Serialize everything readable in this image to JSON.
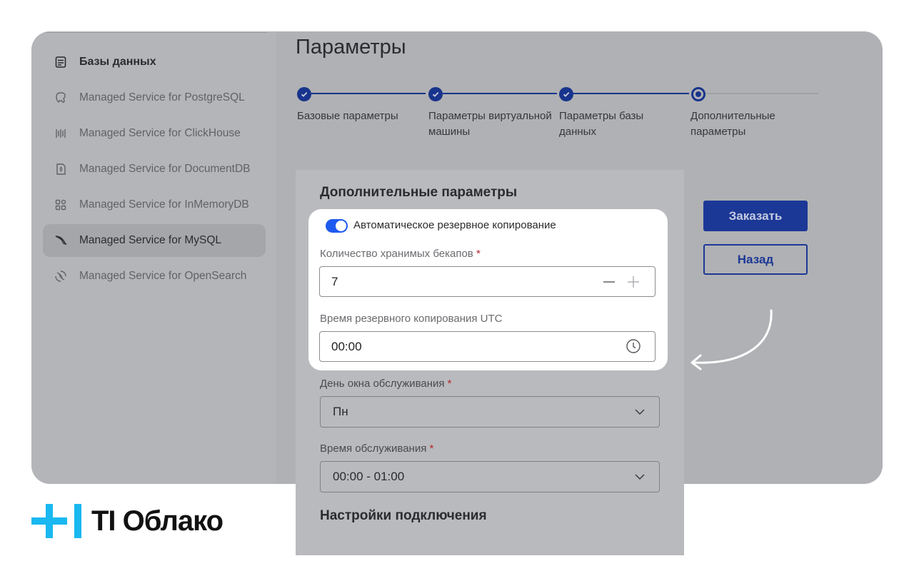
{
  "sidebar": {
    "header": "Базы данных",
    "items": [
      {
        "label": "Managed Service for PostgreSQL",
        "icon": "postgresql-icon"
      },
      {
        "label": "Managed Service for ClickHouse",
        "icon": "clickhouse-icon"
      },
      {
        "label": "Managed Service for DocumentDB",
        "icon": "documentdb-icon"
      },
      {
        "label": "Managed Service for InMemoryDB",
        "icon": "inmemorydb-icon"
      },
      {
        "label": "Managed Service for MySQL",
        "icon": "mysql-icon",
        "active": true
      },
      {
        "label": "Managed Service for OpenSearch",
        "icon": "opensearch-icon"
      }
    ]
  },
  "main": {
    "title": "Параметры",
    "steps": [
      {
        "label": "Базовые параметры",
        "state": "done"
      },
      {
        "label": "Параметры виртуальной машины",
        "state": "done"
      },
      {
        "label": "Параметры базы данных",
        "state": "done"
      },
      {
        "label": "Дополнительные параметры",
        "state": "current"
      }
    ]
  },
  "form": {
    "title": "Дополнительные параметры",
    "auto_backup_label": "Автоматическое резервное копирование",
    "auto_backup_enabled": true,
    "backups_count_label": "Количество хранимых бекапов",
    "backups_count_value": "7",
    "backup_time_label": "Время резервного копирования UTC",
    "backup_time_value": "00:00",
    "maintenance_day_label": "День окна обслуживания",
    "maintenance_day_value": "Пн",
    "maintenance_time_label": "Время обслуживания",
    "maintenance_time_value": "00:00 - 01:00",
    "required_mark": "*",
    "connection_section_title": "Настройки подключения"
  },
  "actions": {
    "order_label": "Заказать",
    "back_label": "Назад"
  },
  "brand": {
    "logo_text": "TI Облако",
    "accent_color": "#1e59f0",
    "logo_cross_color": "#19b8f0"
  }
}
